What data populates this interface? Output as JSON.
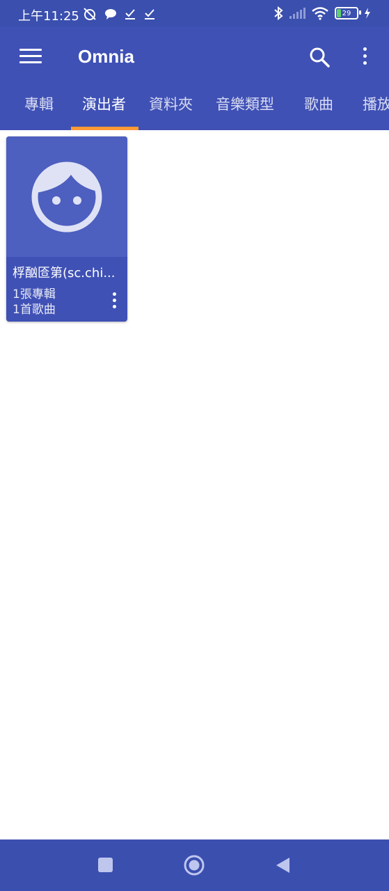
{
  "status_bar": {
    "time": "上午11:25",
    "battery_level": "29"
  },
  "app_bar": {
    "title": "Omnia"
  },
  "tabs": [
    {
      "label": "專輯",
      "active": false
    },
    {
      "label": "演出者",
      "active": true
    },
    {
      "label": "資料夾",
      "active": false
    },
    {
      "label": "音樂類型",
      "active": false
    },
    {
      "label": "歌曲",
      "active": false
    },
    {
      "label": "播放",
      "active": false
    }
  ],
  "artists": [
    {
      "name": "桴酗匼第(sc.chi...",
      "albums": "1張專輯",
      "songs": "1首歌曲"
    }
  ],
  "colors": {
    "primary": "#3f51b5",
    "status_bar": "#3a4fae",
    "tab_indicator": "#ff9b35",
    "background": "#ffffff"
  }
}
